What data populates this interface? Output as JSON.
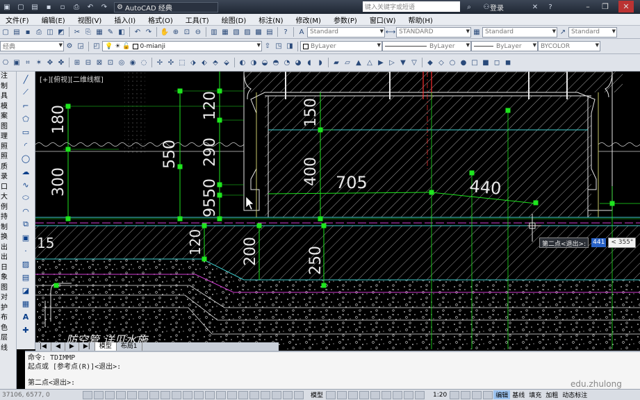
{
  "titlebar": {
    "workspace": "AutoCAD 经典",
    "search_placeholder": "键入关键字或短语",
    "login": "登录"
  },
  "menu": [
    "文件(F)",
    "编辑(E)",
    "视图(V)",
    "插入(I)",
    "格式(O)",
    "工具(T)",
    "绘图(D)",
    "标注(N)",
    "修改(M)",
    "参数(P)",
    "窗口(W)",
    "帮助(H)"
  ],
  "styles": {
    "text_style": "Standard",
    "dim_style": "STANDARD",
    "table_style": "Standard",
    "mleader_style": "Standard"
  },
  "layers": {
    "workspace_combo": "经典",
    "current_layer": "0-mianji",
    "color": "ByLayer",
    "linetype": "ByLayer",
    "lineweight": "ByLayer",
    "plotstyle": "BYCOLOR"
  },
  "left_panel": [
    "注",
    "制",
    "具",
    "模",
    "案",
    "图",
    "理",
    "照",
    "照",
    "质",
    "录",
    "口",
    "大",
    "例",
    "持",
    "制",
    "换",
    "出",
    "出",
    "日",
    "象",
    "图",
    "对",
    "护",
    "布",
    "色",
    "层",
    "线"
  ],
  "canvas": {
    "view_label": "[+][俯视][二维线框]",
    "dims": {
      "d180": "180",
      "d300": "300",
      "d550": "550",
      "d120a": "120",
      "d290": "290",
      "d9550": "9550",
      "d150": "150",
      "d400": "400",
      "d705": "705",
      "d440": "440",
      "d15": "15",
      "d120b": "120",
      "d200": "200",
      "d250": "250"
    },
    "annotation": "防空管 详见水施"
  },
  "dynamic_input": {
    "label": "第二点<退出>:",
    "value": "441",
    "angle": "< 355°"
  },
  "layout_tabs": [
    "模型",
    "布局1"
  ],
  "command": {
    "line1": "命令:  TDIMMP",
    "line2": "起点或 [参考点(R)]<退出>:",
    "line3": "第二点<退出>:"
  },
  "status": {
    "coords": "37106, 6577, 0",
    "model": "模型",
    "scale": "1:20",
    "edit": "编辑",
    "baseline": "基线",
    "fill": "填充",
    "bold": "加粗",
    "dyn_dim": "动态标注"
  },
  "watermark": "edu.zhulong",
  "colors": {
    "dim_green": "#1ee51e",
    "cyan": "#3fd0d0",
    "magenta": "#d23cd2",
    "red": "#ff3030",
    "white": "#e8e8e8",
    "canvas_bg": "#000000"
  }
}
